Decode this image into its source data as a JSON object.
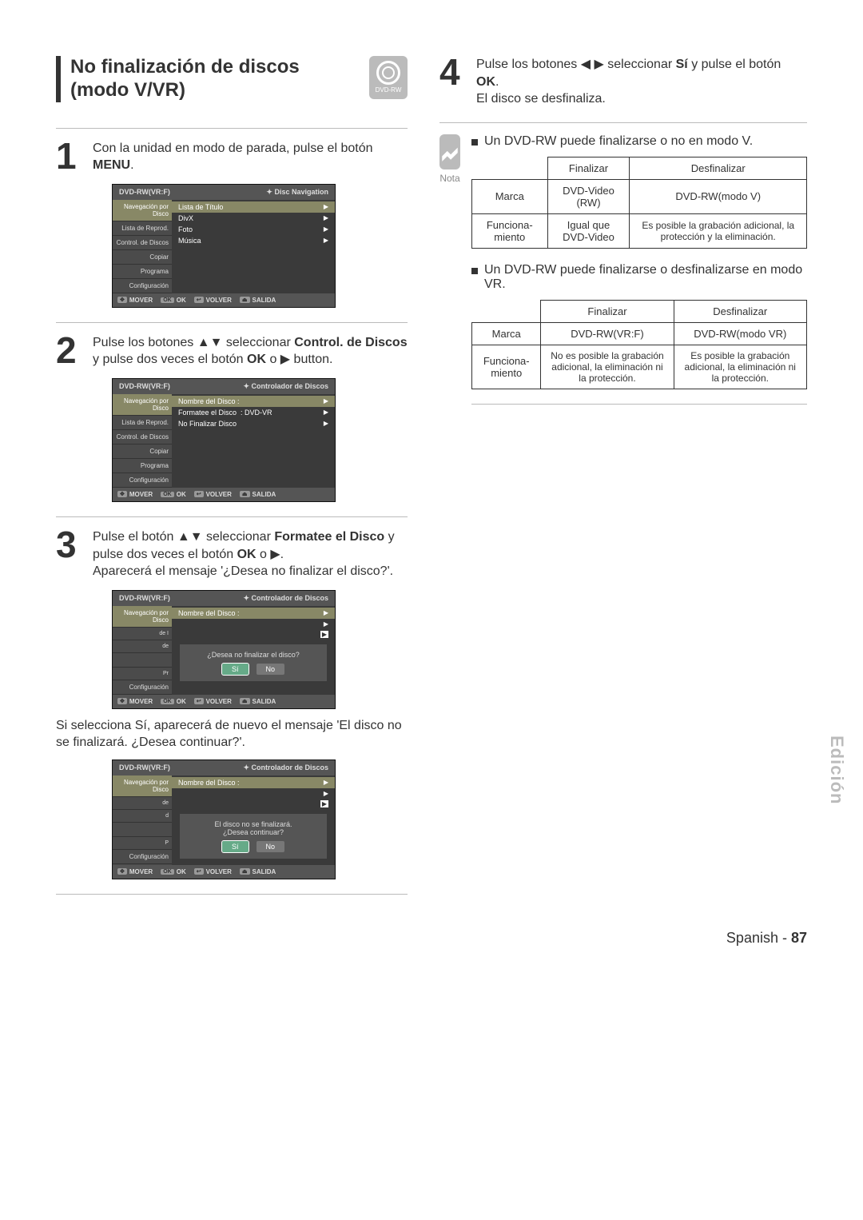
{
  "section_title_line1": "No finalización de discos",
  "section_title_line2": "(modo V/VR)",
  "disc_icon_label": "DVD-RW",
  "step1": {
    "num": "1",
    "text_a": "Con la unidad en modo de parada, pulse el botón",
    "text_b": "MENU",
    "text_c": "."
  },
  "step2": {
    "num": "2",
    "text_a": "Pulse los botones ▲▼ seleccionar ",
    "bold": "Control. de Discos",
    "text_b": " y pulse dos veces el botón ",
    "bold2": "OK",
    "text_c": " o ▶ button."
  },
  "step3": {
    "num": "3",
    "text_a": "Pulse el botón ▲▼ seleccionar ",
    "bold": "Formatee el Disco",
    "text_b": " y pulse dos veces el botón ",
    "bold2": "OK",
    "text_c": " o ▶.",
    "text_d": "Aparecerá el mensaje '¿Desea no finalizar el disco?'."
  },
  "step3_follow": "Si selecciona Sí, aparecerá de nuevo el mensaje 'El disco no se finalizará. ¿Desea continuar?'.",
  "step4": {
    "num": "4",
    "text_a": "Pulse los botones ◀ ▶ seleccionar ",
    "bold": "Sí",
    "text_b": " y pulse el botón ",
    "bold2": "OK",
    "text_c": ".",
    "text_d": "El disco se desfinaliza."
  },
  "osd_common": {
    "title": "DVD-RW(VR:F)",
    "head_right1": "Disc Navigation",
    "head_right2": "Controlador de Discos",
    "foot": {
      "mover": "MOVER",
      "ok": "OK",
      "volver": "VOLVER",
      "salida": "SALIDA"
    }
  },
  "osd_sidebar": {
    "nav": "Navegación por Disco",
    "lista": "Lista de Reprod.",
    "control": "Control. de Discos",
    "copiar": "Copiar",
    "programa": "Programa",
    "config": "Configuración"
  },
  "osd1_items": [
    "Lista de Título",
    "DivX",
    "Foto",
    "Música"
  ],
  "osd2_items": {
    "row1": "Nombre del Disco    :",
    "row2a": "Formatee el Disco",
    "row2b": ": DVD-VR",
    "row3": "No Finalizar Disco"
  },
  "osd3_dialog": {
    "row1": "Nombre del Disco    :",
    "msg": "¿Desea no finalizar el disco?",
    "yes": "Sí",
    "no": "No"
  },
  "osd4_dialog": {
    "row1": "Nombre del Disco    :",
    "msg1": "El disco no se finalizará.",
    "msg2": "¿Desea continuar?",
    "yes": "Sí",
    "no": "No"
  },
  "note_label": "Nota",
  "note_bullet1": "Un DVD-RW puede finalizarse o no en modo V.",
  "table1": {
    "h_final": "Finalizar",
    "h_desf": "Desfinalizar",
    "r_marca": "Marca",
    "r_marca_f": "DVD-Video (RW)",
    "r_marca_d": "DVD-RW(modo V)",
    "r_func": "Funciona-miento",
    "r_func_f": "Igual que DVD-Video",
    "r_func_d": "Es posible la grabación adicional, la protección y la eliminación."
  },
  "note_bullet2": "Un DVD-RW puede finalizarse o desfinalizarse en modo VR.",
  "table2": {
    "h_final": "Finalizar",
    "h_desf": "Desfinalizar",
    "r_marca": "Marca",
    "r_marca_f": "DVD-RW(VR:F)",
    "r_marca_d": "DVD-RW(modo VR)",
    "r_func": "Funciona-miento",
    "r_func_f": "No es posible la grabación adicional, la eliminación ni la protección.",
    "r_func_d": "Es posible la grabación adicional, la eliminación ni la protección."
  },
  "side_label": "Edición",
  "page_foot_a": "Spanish - ",
  "page_foot_b": "87"
}
